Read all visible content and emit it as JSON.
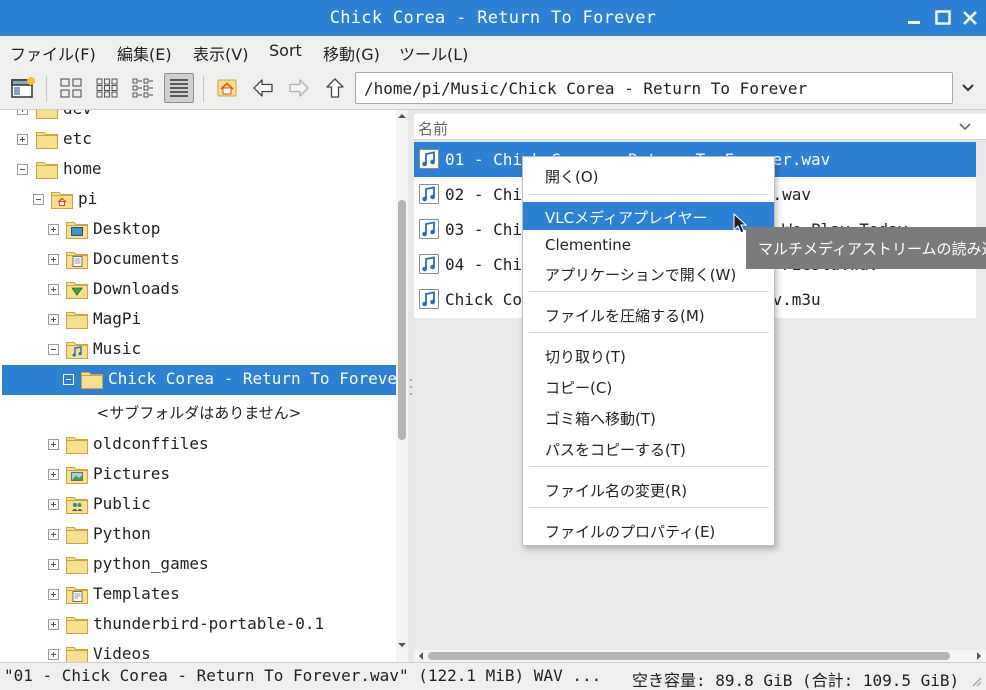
{
  "window": {
    "title": "Chick Corea - Return To Forever"
  },
  "menu": [
    "ファイル(F)",
    "編集(E)",
    "表示(V)",
    "Sort",
    "移動(G)",
    "ツール(L)"
  ],
  "toolbar": {
    "path": "/home/pi/Music/Chick Corea - Return To Forever"
  },
  "tree": {
    "items": [
      {
        "label": "dev",
        "level": 1,
        "expander": "plus",
        "icon": "folder-icon"
      },
      {
        "label": "etc",
        "level": 1,
        "expander": "plus",
        "icon": "folder-icon"
      },
      {
        "label": "home",
        "level": 1,
        "expander": "minus",
        "icon": "folder-icon"
      },
      {
        "label": "pi",
        "level": 2,
        "expander": "minus",
        "icon": "home-folder-icon"
      },
      {
        "label": "Desktop",
        "level": 3,
        "expander": "plus",
        "icon": "desktop-folder-icon"
      },
      {
        "label": "Documents",
        "level": 3,
        "expander": "plus",
        "icon": "documents-folder-icon"
      },
      {
        "label": "Downloads",
        "level": 3,
        "expander": "plus",
        "icon": "downloads-folder-icon"
      },
      {
        "label": "MagPi",
        "level": 3,
        "expander": "plus",
        "icon": "folder-icon"
      },
      {
        "label": "Music",
        "level": 3,
        "expander": "minus",
        "icon": "music-folder-icon"
      },
      {
        "label": "Chick Corea - Return To Forever",
        "level": 4,
        "expander": "minus",
        "icon": "folder-icon",
        "selected": true
      },
      {
        "label": "oldconffiles",
        "level": 3,
        "expander": "plus",
        "icon": "folder-icon"
      },
      {
        "label": "Pictures",
        "level": 3,
        "expander": "plus",
        "icon": "pictures-folder-icon"
      },
      {
        "label": "Public",
        "level": 3,
        "expander": "plus",
        "icon": "public-folder-icon"
      },
      {
        "label": "Python",
        "level": 3,
        "expander": "plus",
        "icon": "folder-icon"
      },
      {
        "label": "python_games",
        "level": 3,
        "expander": "plus",
        "icon": "folder-icon"
      },
      {
        "label": "Templates",
        "level": 3,
        "expander": "plus",
        "icon": "templates-folder-icon"
      },
      {
        "label": "thunderbird-portable-0.1",
        "level": 3,
        "expander": "plus",
        "icon": "folder-icon"
      },
      {
        "label": "Videos",
        "level": 3,
        "expander": "plus",
        "icon": "folder-icon"
      }
    ],
    "no_subfolders": "<サブフォルダはありません>"
  },
  "filelist": {
    "column_name": "名前",
    "files": [
      {
        "name": "01 - Chick Corea - Return To Forever.wav",
        "selected": true
      },
      {
        "name": "02 - Chick Corea - Crystal Silence.wav"
      },
      {
        "name": "03 - Chick Corea - What Game Shall We Play Today"
      },
      {
        "name": "04 - Chick Corea - Sometime Ago La Fiesta.wav"
      },
      {
        "name": "Chick Corea - Return To Forever.wav.m3u"
      }
    ]
  },
  "context_menu": {
    "items": [
      {
        "label": "開く(O)",
        "highlighted": false
      },
      {
        "label": "VLCメディアプレイヤー",
        "highlighted": true
      },
      {
        "label": "Clementine",
        "highlighted": false
      },
      {
        "label": "アプリケーションで開く(W)",
        "highlighted": false
      },
      {
        "label": "ファイルを圧縮する(M)",
        "highlighted": false
      },
      {
        "label": "切り取り(T)",
        "highlighted": false
      },
      {
        "label": "コピー(C)",
        "highlighted": false
      },
      {
        "label": "ゴミ箱へ移動(T)",
        "highlighted": false
      },
      {
        "label": "パスをコピーする(T)",
        "highlighted": false
      },
      {
        "label": "ファイル名の変更(R)",
        "highlighted": false
      },
      {
        "label": "ファイルのプロパティ(E)",
        "highlighted": false
      }
    ]
  },
  "tooltip": "マルチメディアストリームの読み込みと再生",
  "status": {
    "left": "\"01 - Chick Corea - Return To Forever.wav\" (122.1 MiB) WAV ...",
    "right": "空き容量: 89.8 GiB (合計: 109.5 GiB)"
  },
  "colors": {
    "accent": "#2c81d6",
    "folder": "#f7e08c",
    "folder_edge": "#c9a642",
    "music_icon": "#2c6fb8"
  }
}
